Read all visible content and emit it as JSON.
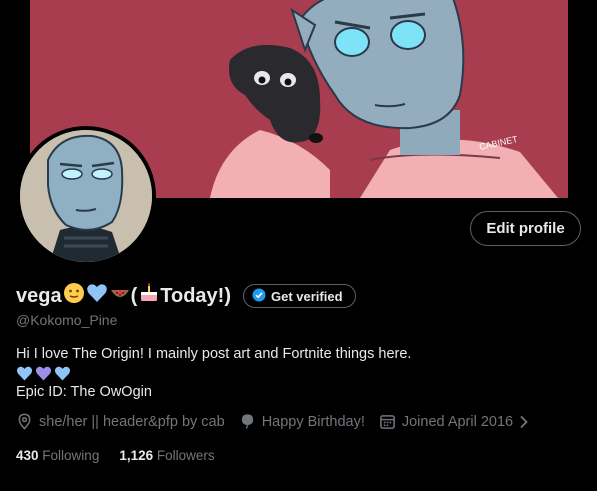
{
  "profile": {
    "name": "vega",
    "name_suffix": "(",
    "birthday_text": "Today!)",
    "handle": "@Kokomo_Pine",
    "edit_label": "Edit profile",
    "verify_label": "Get verified",
    "bio_line1": "Hi I love The Origin! I mainly post art and Fortnite things here.",
    "bio_line3": "Epic ID: The OwOgin",
    "pronouns": "she/her || header&pfp by cab",
    "birthday": "Happy Birthday!",
    "joined": "Joined April 2016",
    "following_count": "430",
    "following_label": "Following",
    "followers_count": "1,126",
    "followers_label": "Followers",
    "header_signature": "CABINET"
  },
  "icons": {
    "verify": "verified-badge-icon",
    "location": "location-pin-icon",
    "birthday": "balloon-icon",
    "calendar": "calendar-icon",
    "chevron": "chevron-right-icon",
    "name_emojis": [
      "slightly-smiling-face",
      "blue-heart",
      "watermelon",
      "birthday-cake"
    ],
    "bio_hearts": [
      "blue-heart",
      "purple-heart",
      "blue-heart"
    ]
  },
  "colors": {
    "header_bg": "#a83d4f",
    "accent_blue": "#1d9bf0",
    "muted": "#71767b",
    "text": "#e7e9ea",
    "border": "#536471",
    "heart_blue": "#8ec5f4",
    "heart_purple": "#9d8ee8"
  }
}
